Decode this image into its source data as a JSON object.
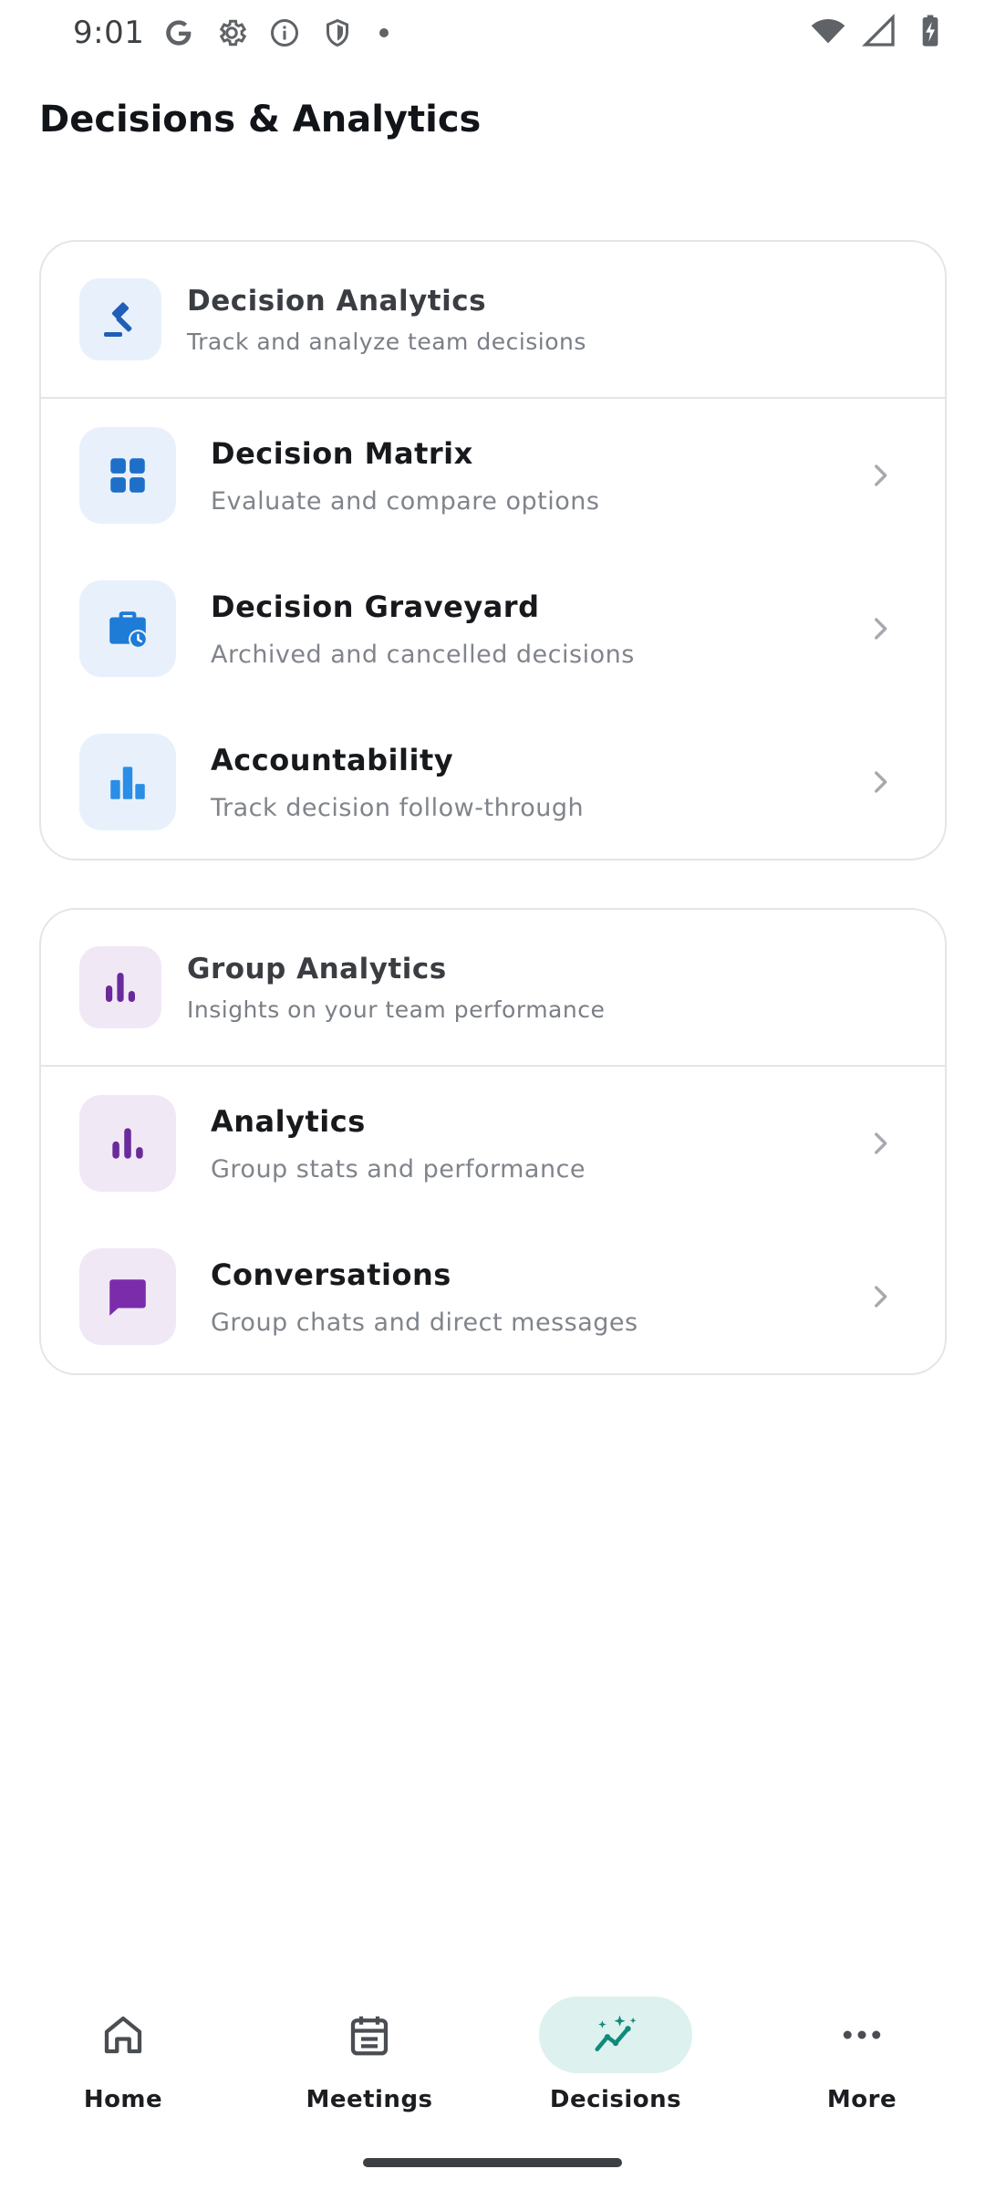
{
  "status_bar": {
    "time": "9:01",
    "icons_left": [
      "google-icon",
      "settings-icon",
      "info-icon",
      "shield-icon"
    ],
    "icons_right": [
      "wifi-icon",
      "signal-icon",
      "battery-icon"
    ]
  },
  "header": {
    "title": "Decisions & Analytics"
  },
  "cards": [
    {
      "header": {
        "icon": "gavel-icon",
        "title": "Decision Analytics",
        "subtitle": "Track and analyze team decisions",
        "accent": "#1f5fb8"
      },
      "items": [
        {
          "icon": "grid-icon",
          "title": "Decision Matrix",
          "subtitle": "Evaluate and compare options",
          "accent": "#1e6fc9"
        },
        {
          "icon": "briefcase-clock-icon",
          "title": "Decision Graveyard",
          "subtitle": "Archived and cancelled decisions",
          "accent": "#1e7bd6"
        },
        {
          "icon": "bar-chart-icon",
          "title": "Accountability",
          "subtitle": "Track decision follow-through",
          "accent": "#2a8de6"
        }
      ]
    },
    {
      "header": {
        "icon": "bar-chart-icon",
        "title": "Group Analytics",
        "subtitle": "Insights on your team performance",
        "accent": "#6a2a9a"
      },
      "items": [
        {
          "icon": "bar-chart-icon",
          "title": "Analytics",
          "subtitle": "Group stats and performance",
          "accent": "#6a2a9a"
        },
        {
          "icon": "chat-icon",
          "title": "Conversations",
          "subtitle": "Group chats and direct messages",
          "accent": "#7b2cab"
        }
      ]
    }
  ],
  "bottom_nav": {
    "active": "Decisions",
    "active_color": "#0f8a7a",
    "items": [
      {
        "icon": "home-icon",
        "label": "Home"
      },
      {
        "icon": "calendar-icon",
        "label": "Meetings"
      },
      {
        "icon": "trend-sparkle-icon",
        "label": "Decisions"
      },
      {
        "icon": "more-dots-icon",
        "label": "More"
      }
    ]
  }
}
